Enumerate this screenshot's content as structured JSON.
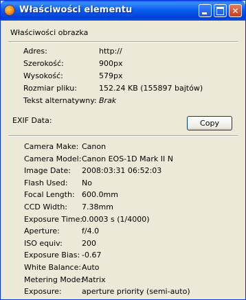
{
  "window": {
    "title": "Właściwości elementu"
  },
  "image_section": {
    "title": "Właściwości obrazka",
    "rows": [
      {
        "label": "Adres:",
        "value": "http://"
      },
      {
        "label": "Szerokość:",
        "value": "900px"
      },
      {
        "label": "Wysokość:",
        "value": "579px"
      },
      {
        "label": "Rozmiar pliku:",
        "value": "152.24 KB (155897 bajtów)"
      },
      {
        "label": "Tekst alternatywny:",
        "value": "Brak"
      }
    ]
  },
  "exif_section": {
    "title": "EXIF Data:",
    "copy_label": "Copy",
    "rows": [
      {
        "label": "Camera Make:",
        "value": "Canon"
      },
      {
        "label": "Camera Model:",
        "value": "Canon EOS-1D Mark II N"
      },
      {
        "label": "Image Date:",
        "value": "2008:03:31 06:52:03"
      },
      {
        "label": "Flash Used:",
        "value": "No"
      },
      {
        "label": "Focal Length:",
        "value": "600.0mm"
      },
      {
        "label": "CCD Width:",
        "value": "7.38mm"
      },
      {
        "label": "Exposure Time:",
        "value": "0.0003 s (1/4000)"
      },
      {
        "label": "Aperture:",
        "value": "f/4.0"
      },
      {
        "label": "ISO equiv:",
        "value": "200"
      },
      {
        "label": "Exposure Bias:",
        "value": "-0.67"
      },
      {
        "label": "White Balance:",
        "value": "Auto"
      },
      {
        "label": "Metering Mode:",
        "value": "Matrix"
      },
      {
        "label": "Exposure:",
        "value": "aperture priority (semi-auto)"
      }
    ]
  },
  "colors": {
    "titlebar": "#0a5ff0",
    "dialog_bg": "#ece9d8",
    "close_button": "#c4401f"
  },
  "icons": {
    "app": "firefox-icon",
    "minimize": "minimize-icon",
    "maximize": "maximize-icon",
    "close": "close-icon"
  }
}
